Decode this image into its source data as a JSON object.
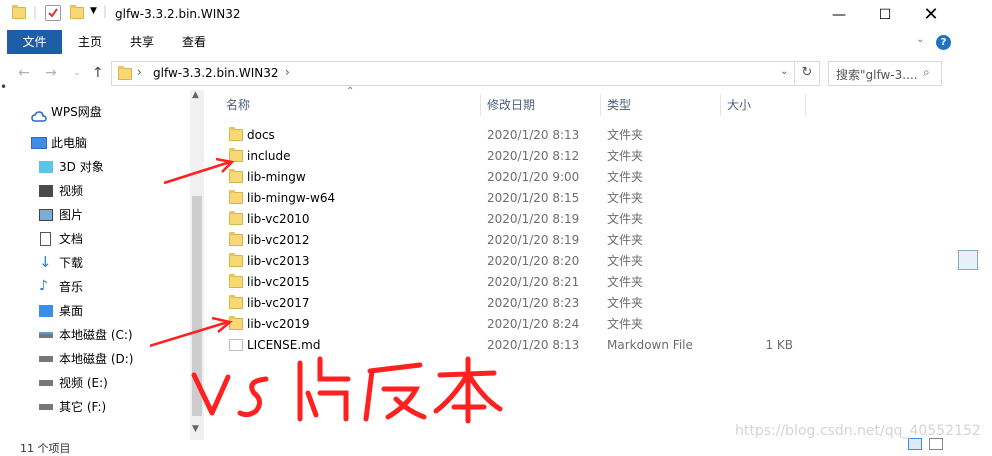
{
  "window": {
    "title": "glfw-3.3.2.bin.WIN32",
    "minimize_icon": "minimize-icon",
    "maximize_icon": "maximize-icon",
    "close_icon": "close-icon"
  },
  "ribbon": {
    "tabs": [
      "文件",
      "主页",
      "共享",
      "查看"
    ]
  },
  "address": {
    "path": "glfw-3.3.2.bin.WIN32",
    "search_placeholder": "搜索\"glfw-3...."
  },
  "nav": {
    "items": [
      {
        "label": "WPS网盘",
        "icon": "cloud-icon"
      },
      {
        "label": "此电脑",
        "icon": "computer-icon"
      },
      {
        "label": "3D 对象",
        "icon": "cube-icon"
      },
      {
        "label": "视频",
        "icon": "video-icon"
      },
      {
        "label": "图片",
        "icon": "picture-icon"
      },
      {
        "label": "文档",
        "icon": "document-icon"
      },
      {
        "label": "下载",
        "icon": "download-icon"
      },
      {
        "label": "音乐",
        "icon": "music-icon"
      },
      {
        "label": "桌面",
        "icon": "desktop-icon"
      },
      {
        "label": "本地磁盘 (C:)",
        "icon": "drive-c-icon"
      },
      {
        "label": "本地磁盘 (D:)",
        "icon": "drive-icon"
      },
      {
        "label": "视频 (E:)",
        "icon": "drive-icon"
      },
      {
        "label": "其它 (F:)",
        "icon": "drive-icon"
      }
    ]
  },
  "columns": {
    "name": "名称",
    "date": "修改日期",
    "type": "类型",
    "size": "大小"
  },
  "files": [
    {
      "name": "docs",
      "date": "2020/1/20 8:13",
      "type": "文件夹",
      "size": ""
    },
    {
      "name": "include",
      "date": "2020/1/20 8:12",
      "type": "文件夹",
      "size": ""
    },
    {
      "name": "lib-mingw",
      "date": "2020/1/20 9:00",
      "type": "文件夹",
      "size": ""
    },
    {
      "name": "lib-mingw-w64",
      "date": "2020/1/20 8:15",
      "type": "文件夹",
      "size": ""
    },
    {
      "name": "lib-vc2010",
      "date": "2020/1/20 8:19",
      "type": "文件夹",
      "size": ""
    },
    {
      "name": "lib-vc2012",
      "date": "2020/1/20 8:19",
      "type": "文件夹",
      "size": ""
    },
    {
      "name": "lib-vc2013",
      "date": "2020/1/20 8:20",
      "type": "文件夹",
      "size": ""
    },
    {
      "name": "lib-vc2015",
      "date": "2020/1/20 8:21",
      "type": "文件夹",
      "size": ""
    },
    {
      "name": "lib-vc2017",
      "date": "2020/1/20 8:23",
      "type": "文件夹",
      "size": ""
    },
    {
      "name": "lib-vc2019",
      "date": "2020/1/20 8:24",
      "type": "文件夹",
      "size": ""
    },
    {
      "name": "LICENSE.md",
      "date": "2020/1/20 8:13",
      "type": "Markdown File",
      "size": "1 KB"
    }
  ],
  "status": {
    "items_count": "11 个项目"
  },
  "annotation": "VS版本",
  "watermark": "https://blog.csdn.net/qq_40552152",
  "colors": {
    "file_tab": "#1e5ea8",
    "annotation": "#ff2020",
    "folder": "#f8d775"
  }
}
